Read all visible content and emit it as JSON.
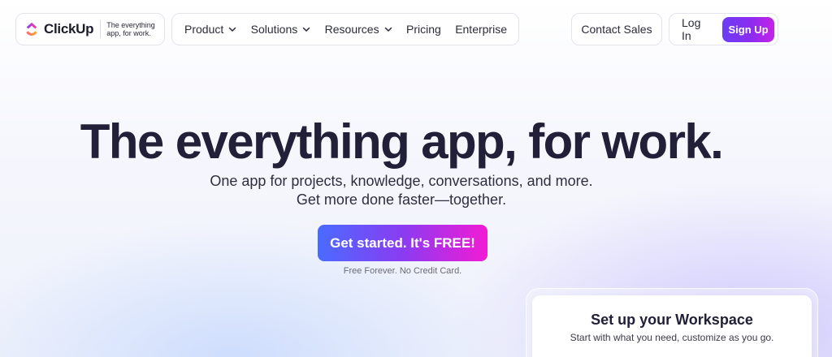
{
  "brand": {
    "name": "ClickUp",
    "tagline": "The everything app, for work."
  },
  "nav": {
    "menu": [
      {
        "label": "Product",
        "has_dropdown": true
      },
      {
        "label": "Solutions",
        "has_dropdown": true
      },
      {
        "label": "Resources",
        "has_dropdown": true
      },
      {
        "label": "Pricing",
        "has_dropdown": false
      },
      {
        "label": "Enterprise",
        "has_dropdown": false
      }
    ],
    "contact_label": "Contact Sales",
    "login_label": "Log In",
    "signup_label": "Sign Up"
  },
  "hero": {
    "title": "The everything app, for work.",
    "subtitle_line1": "One app for projects, knowledge, conversations, and more.",
    "subtitle_line2": "Get more done faster—together.",
    "cta_label": "Get started. It's FREE!",
    "cta_note": "Free Forever. No Credit Card."
  },
  "workspace_card": {
    "title": "Set up your Workspace",
    "subtitle": "Start with what you need, customize as you go."
  },
  "colors": {
    "signup_gradient": [
      "#6b3df5",
      "#c622e8"
    ],
    "cta_gradient": [
      "#4a6bff",
      "#8a3cf2",
      "#f21bd4"
    ],
    "heading": "#222038"
  },
  "icons": {
    "logo": "clickup-logo-icon",
    "dropdown": "chevron-down-icon"
  }
}
